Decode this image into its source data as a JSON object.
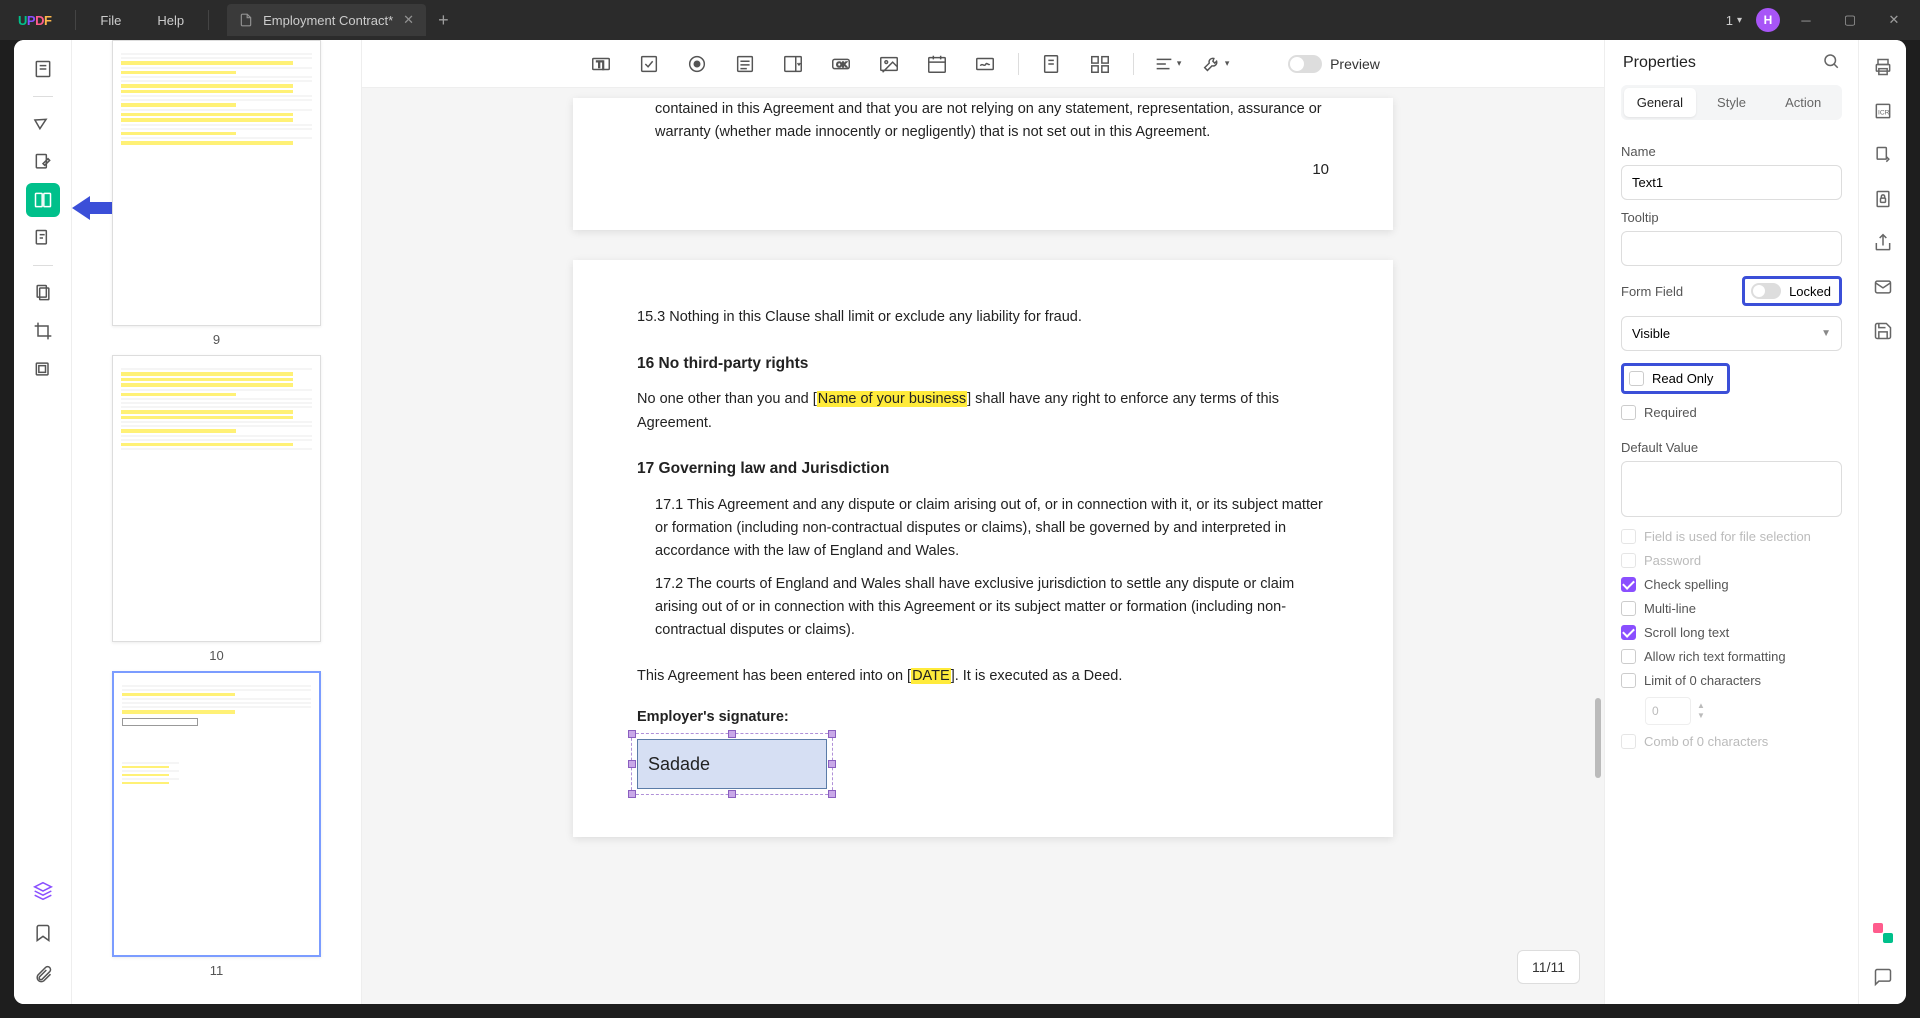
{
  "titlebar": {
    "menu_file": "File",
    "menu_help": "Help",
    "tab_title": "Employment Contract*",
    "page_dropdown": "1",
    "avatar_letter": "H"
  },
  "thumbnails": {
    "page9": "9",
    "page10": "10",
    "page11": "11"
  },
  "toolbar": {
    "preview_label": "Preview"
  },
  "document": {
    "p1": "contained in this Agreement and that you are not relying on any statement, representation, assurance or warranty (whether made innocently or negligently) that is not set out in this Agreement.",
    "pagenum10": "10",
    "p153": "15.3   Nothing in this Clause shall limit or exclude any liability for fraud.",
    "h16": "16   No third-party rights",
    "p16a": "No one other than you and [",
    "p16b": "Name of your business",
    "p16c": "] shall have any right to enforce any terms of this Agreement.",
    "h17": "17   Governing law and Jurisdiction",
    "p171": "17.1 This Agreement and any dispute or claim arising out of, or in connection with it, or its subject matter or formation (including non-contractual disputes or claims), shall be governed by and interpreted in accordance with the law of England and Wales.",
    "p172": "17.2 The courts of England and Wales shall have exclusive jurisdiction to settle any dispute or claim arising out of or in connection with this Agreement or its subject matter or formation (including non-contractual disputes or claims).",
    "pdate_a": "This Agreement has been entered into on [",
    "pdate_b": "DATE",
    "pdate_c": "]. It is executed as a Deed.",
    "employer_sig_label": "Employer's signature:",
    "field_value": "Sadade",
    "page_indicator": "11/11"
  },
  "properties": {
    "title": "Properties",
    "tab_general": "General",
    "tab_style": "Style",
    "tab_action": "Action",
    "name_label": "Name",
    "name_value": "Text1",
    "tooltip_label": "Tooltip",
    "tooltip_value": "",
    "formfield_label": "Form Field",
    "locked_label": "Locked",
    "visibility_value": "Visible",
    "readonly_label": "Read Only",
    "required_label": "Required",
    "default_label": "Default Value",
    "default_value": "",
    "chk_file": "Field is used for file selection",
    "chk_password": "Password",
    "chk_spelling": "Check spelling",
    "chk_multiline": "Multi-line",
    "chk_scroll": "Scroll long text",
    "chk_rich": "Allow rich text formatting",
    "chk_limit": "Limit of 0 characters",
    "limit_value": "0",
    "chk_comb": "Comb of 0 characters"
  }
}
